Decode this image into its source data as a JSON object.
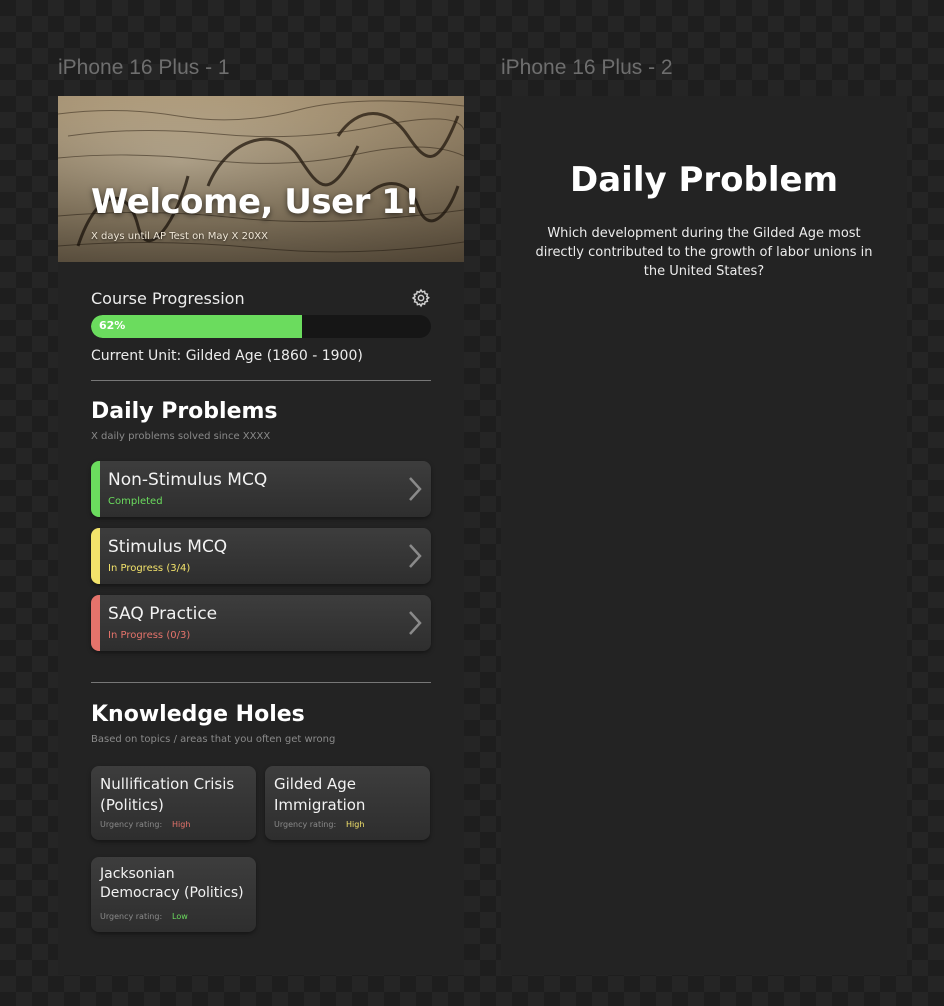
{
  "frames": {
    "frame1_label": "iPhone 16 Plus - 1",
    "frame2_label": "iPhone 16 Plus - 2"
  },
  "hero": {
    "title": "Welcome, User 1!",
    "subtitle": "X days until AP Test on May X 20XX",
    "background_image": "We the People constitution parchment"
  },
  "progression": {
    "label": "Course Progression",
    "percent": 62,
    "percent_label": "62%",
    "current_unit": "Current Unit: Gilded Age (1860 - 1900)",
    "settings_icon": "gear-icon"
  },
  "daily_problems": {
    "title": "Daily Problems",
    "subtitle": "X daily problems solved since XXXX",
    "items": [
      {
        "title": "Non-Stimulus MCQ",
        "status": "Completed",
        "color": "#6bdc5e"
      },
      {
        "title": "Stimulus MCQ",
        "status": "In Progress (3/4)",
        "color": "#f3e36b"
      },
      {
        "title": "SAQ Practice",
        "status": "In Progress (0/3)",
        "color": "#e5736b"
      }
    ]
  },
  "knowledge_holes": {
    "title": "Knowledge Holes",
    "subtitle": "Based on topics / areas that you often get wrong",
    "rating_label": "Urgency rating:",
    "items": [
      {
        "title": "Nullification Crisis (Politics)",
        "urgency": "High",
        "color": "#e5736b"
      },
      {
        "title": "Gilded Age Immigration",
        "urgency": "High",
        "color": "#f3e36b"
      },
      {
        "title": "Jacksonian Democracy (Politics)",
        "urgency": "Low",
        "color": "#6bdc5e"
      }
    ]
  },
  "daily_problem_screen": {
    "title": "Daily Problem",
    "question": "Which development during the Gilded Age most directly contributed to the growth of labor unions in the United States?"
  }
}
